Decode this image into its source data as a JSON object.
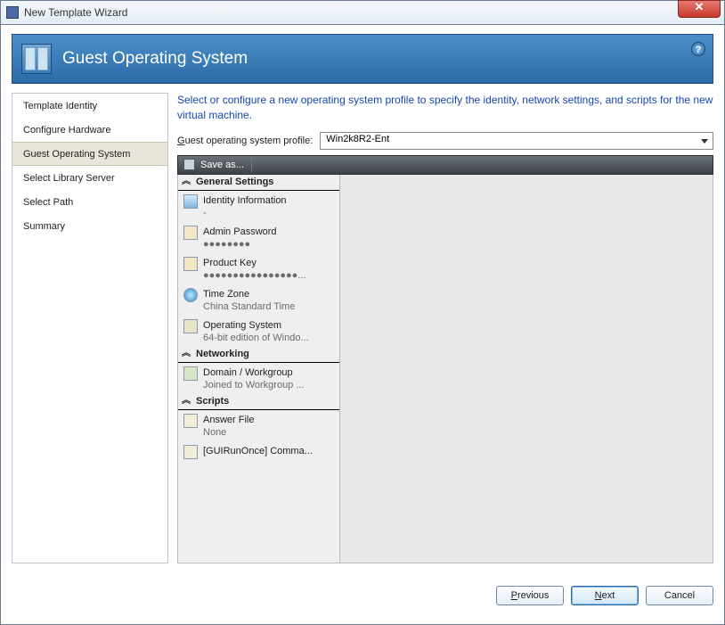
{
  "window": {
    "title": "New Template Wizard"
  },
  "header": {
    "title": "Guest Operating System"
  },
  "sidebar": {
    "items": [
      {
        "label": "Template Identity"
      },
      {
        "label": "Configure Hardware"
      },
      {
        "label": "Guest Operating System"
      },
      {
        "label": "Select Library Server"
      },
      {
        "label": "Select Path"
      },
      {
        "label": "Summary"
      }
    ],
    "active_index": 2
  },
  "main": {
    "intro": "Select or configure a new operating system profile to specify the identity, network settings, and scripts for the new virtual machine.",
    "profile_label": "Guest operating system profile:",
    "profile_value": "Win2k8R2-Ent",
    "toolbar": {
      "save_as": "Save as..."
    },
    "groups": [
      {
        "title": "General Settings",
        "items": [
          {
            "label": "Identity Information",
            "sub": "-",
            "icon": "tag"
          },
          {
            "label": "Admin Password",
            "sub": "●●●●●●●●",
            "icon": "pwd"
          },
          {
            "label": "Product Key",
            "sub": "●●●●●●●●●●●●●●●●...",
            "icon": "key"
          },
          {
            "label": "Time Zone",
            "sub": "China Standard Time",
            "icon": "globe"
          },
          {
            "label": "Operating System",
            "sub": "64-bit edition of Windo...",
            "icon": "os"
          }
        ]
      },
      {
        "title": "Networking",
        "items": [
          {
            "label": "Domain / Workgroup",
            "sub": "Joined to Workgroup ...",
            "icon": "net"
          }
        ]
      },
      {
        "title": "Scripts",
        "items": [
          {
            "label": "Answer File",
            "sub": "None",
            "icon": "file"
          },
          {
            "label": "[GUIRunOnce] Comma...",
            "sub": "",
            "icon": "file"
          }
        ]
      }
    ]
  },
  "footer": {
    "previous": "Previous",
    "next": "Next",
    "cancel": "Cancel"
  }
}
